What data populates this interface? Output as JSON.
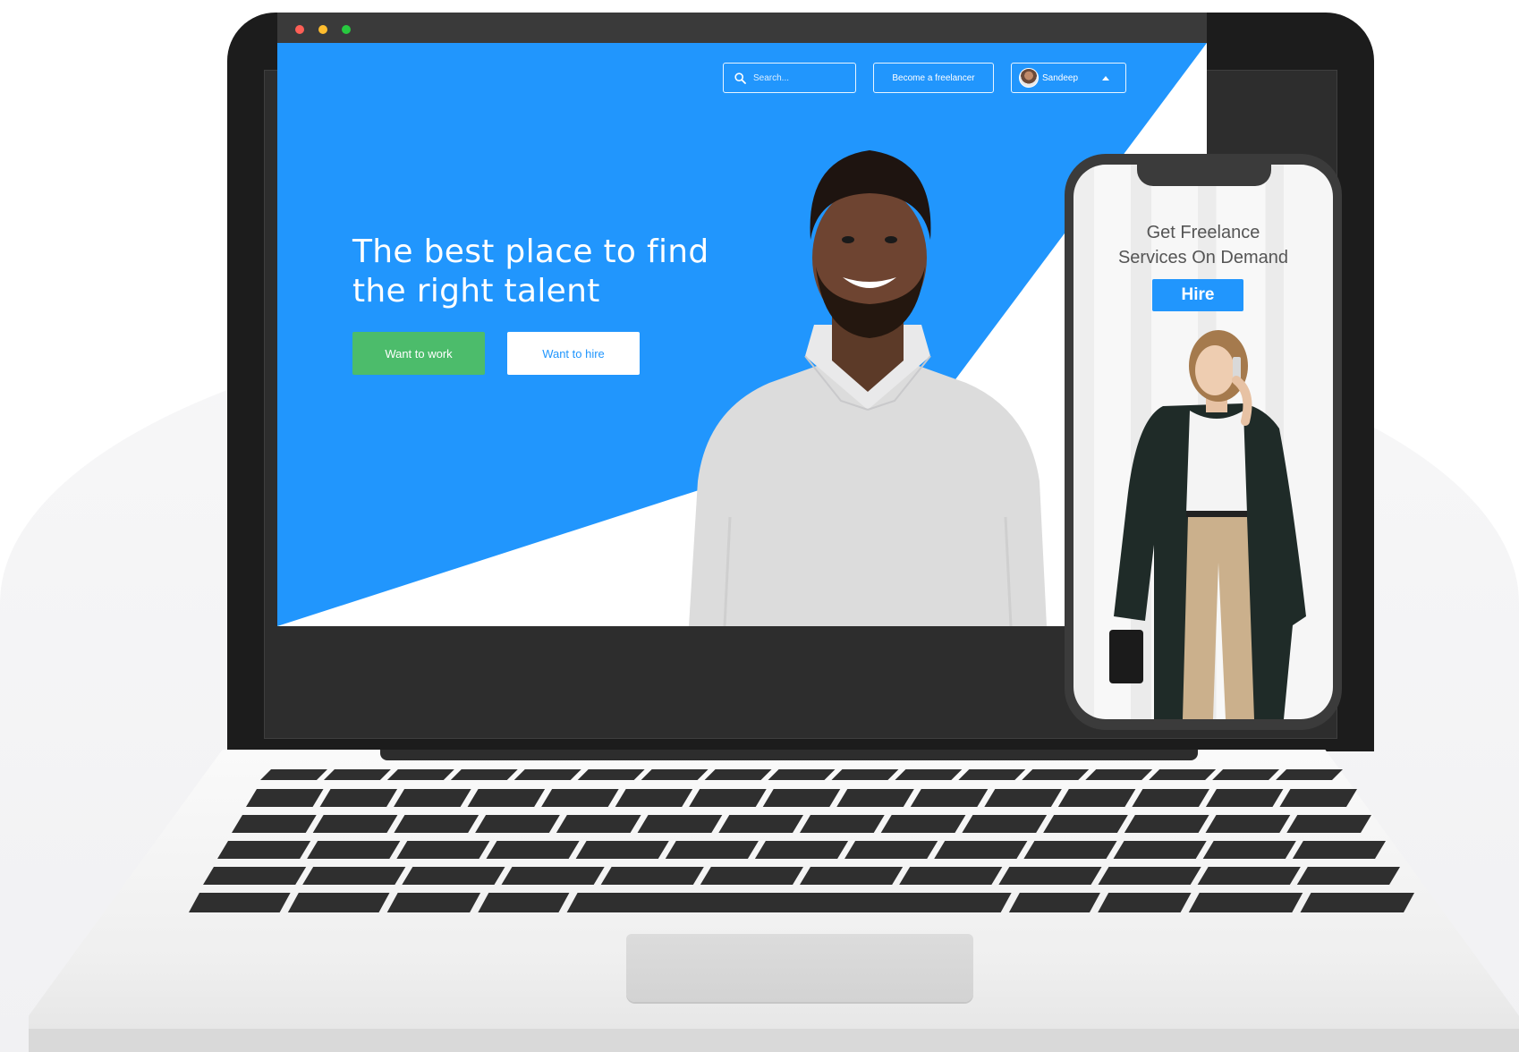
{
  "browser": {
    "search_placeholder": "Search...",
    "become_freelancer_label": "Become a freelancer",
    "user_name": "Sandeep"
  },
  "hero": {
    "title": "The best place to find the right talent",
    "want_to_work_label": "Want to work",
    "want_to_hire_label": "Want to hire"
  },
  "phone": {
    "title_line1": "Get Freelance",
    "title_line2": "Services On Demand",
    "hire_label": "Hire"
  },
  "colors": {
    "brand_blue": "#2196fd",
    "work_green": "#4cbc6b",
    "device_dark": "#2d2d2d"
  },
  "icons": {
    "search": "search-icon",
    "caret": "caret-up-icon",
    "avatar": "user-avatar"
  }
}
